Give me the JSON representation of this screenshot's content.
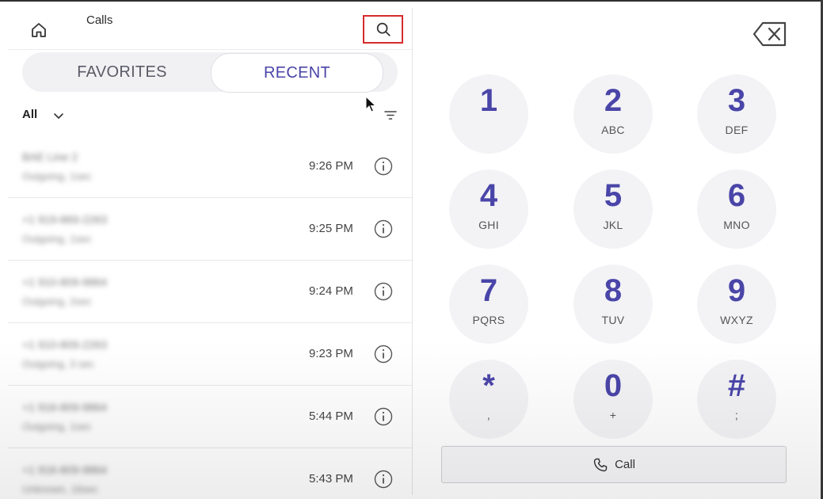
{
  "header": {
    "title": "Calls"
  },
  "tabs": [
    {
      "label": "FAVORITES"
    },
    {
      "label": "RECENT"
    }
  ],
  "filter": {
    "selected": "All"
  },
  "calls": [
    {
      "name": "BAE Line 2",
      "detail": "Outgoing, 1sec",
      "time": "9:26 PM"
    },
    {
      "name": "+1 919-869-2263",
      "detail": "Outgoing, 1sec",
      "time": "9:25 PM"
    },
    {
      "name": "+1 910-809-9864",
      "detail": "Outgoing, 2sec",
      "time": "9:24 PM"
    },
    {
      "name": "+1 910-809-2263",
      "detail": "Outgoing, 3 sec",
      "time": "9:23 PM"
    },
    {
      "name": "+1 916-809-9864",
      "detail": "Outgoing, 1sec",
      "time": "5:44 PM"
    },
    {
      "name": "+1 916-809-9864",
      "detail": "Unknown, 16sec",
      "time": "5:43 PM"
    }
  ],
  "keypad": [
    {
      "digit": "1",
      "letters": ""
    },
    {
      "digit": "2",
      "letters": "ABC"
    },
    {
      "digit": "3",
      "letters": "DEF"
    },
    {
      "digit": "4",
      "letters": "GHI"
    },
    {
      "digit": "5",
      "letters": "JKL"
    },
    {
      "digit": "6",
      "letters": "MNO"
    },
    {
      "digit": "7",
      "letters": "PQRS"
    },
    {
      "digit": "8",
      "letters": "TUV"
    },
    {
      "digit": "9",
      "letters": "WXYZ"
    },
    {
      "digit": "*",
      "letters": ","
    },
    {
      "digit": "0",
      "letters": "+"
    },
    {
      "digit": "#",
      "letters": ";"
    }
  ],
  "call_button": {
    "label": "Call"
  },
  "colors": {
    "accent": "#4a45a8",
    "highlight_box": "#d62b2b"
  },
  "icons": {
    "home": "home-icon",
    "search": "search-icon",
    "filter_chevron": "chevron-down-icon",
    "sort": "sort-icon",
    "info": "info-icon",
    "backspace": "backspace-icon",
    "phone": "phone-icon"
  }
}
